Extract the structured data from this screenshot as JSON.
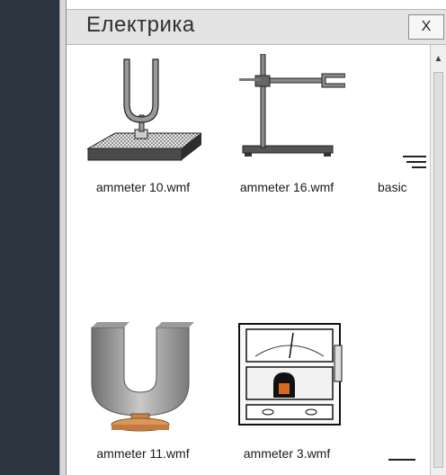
{
  "panel": {
    "title": "Електрика",
    "close_label": "X"
  },
  "files": [
    {
      "label": "ammeter 10.wmf",
      "icon": "tuning-fork-icon"
    },
    {
      "label": "ammeter 16.wmf",
      "icon": "lab-stand-icon"
    },
    {
      "label": "basic",
      "icon": "ground-symbol-icon"
    },
    {
      "label": "ammeter 11.wmf",
      "icon": "u-magnet-icon"
    },
    {
      "label": "ammeter 3.wmf",
      "icon": "analog-meter-icon"
    }
  ]
}
